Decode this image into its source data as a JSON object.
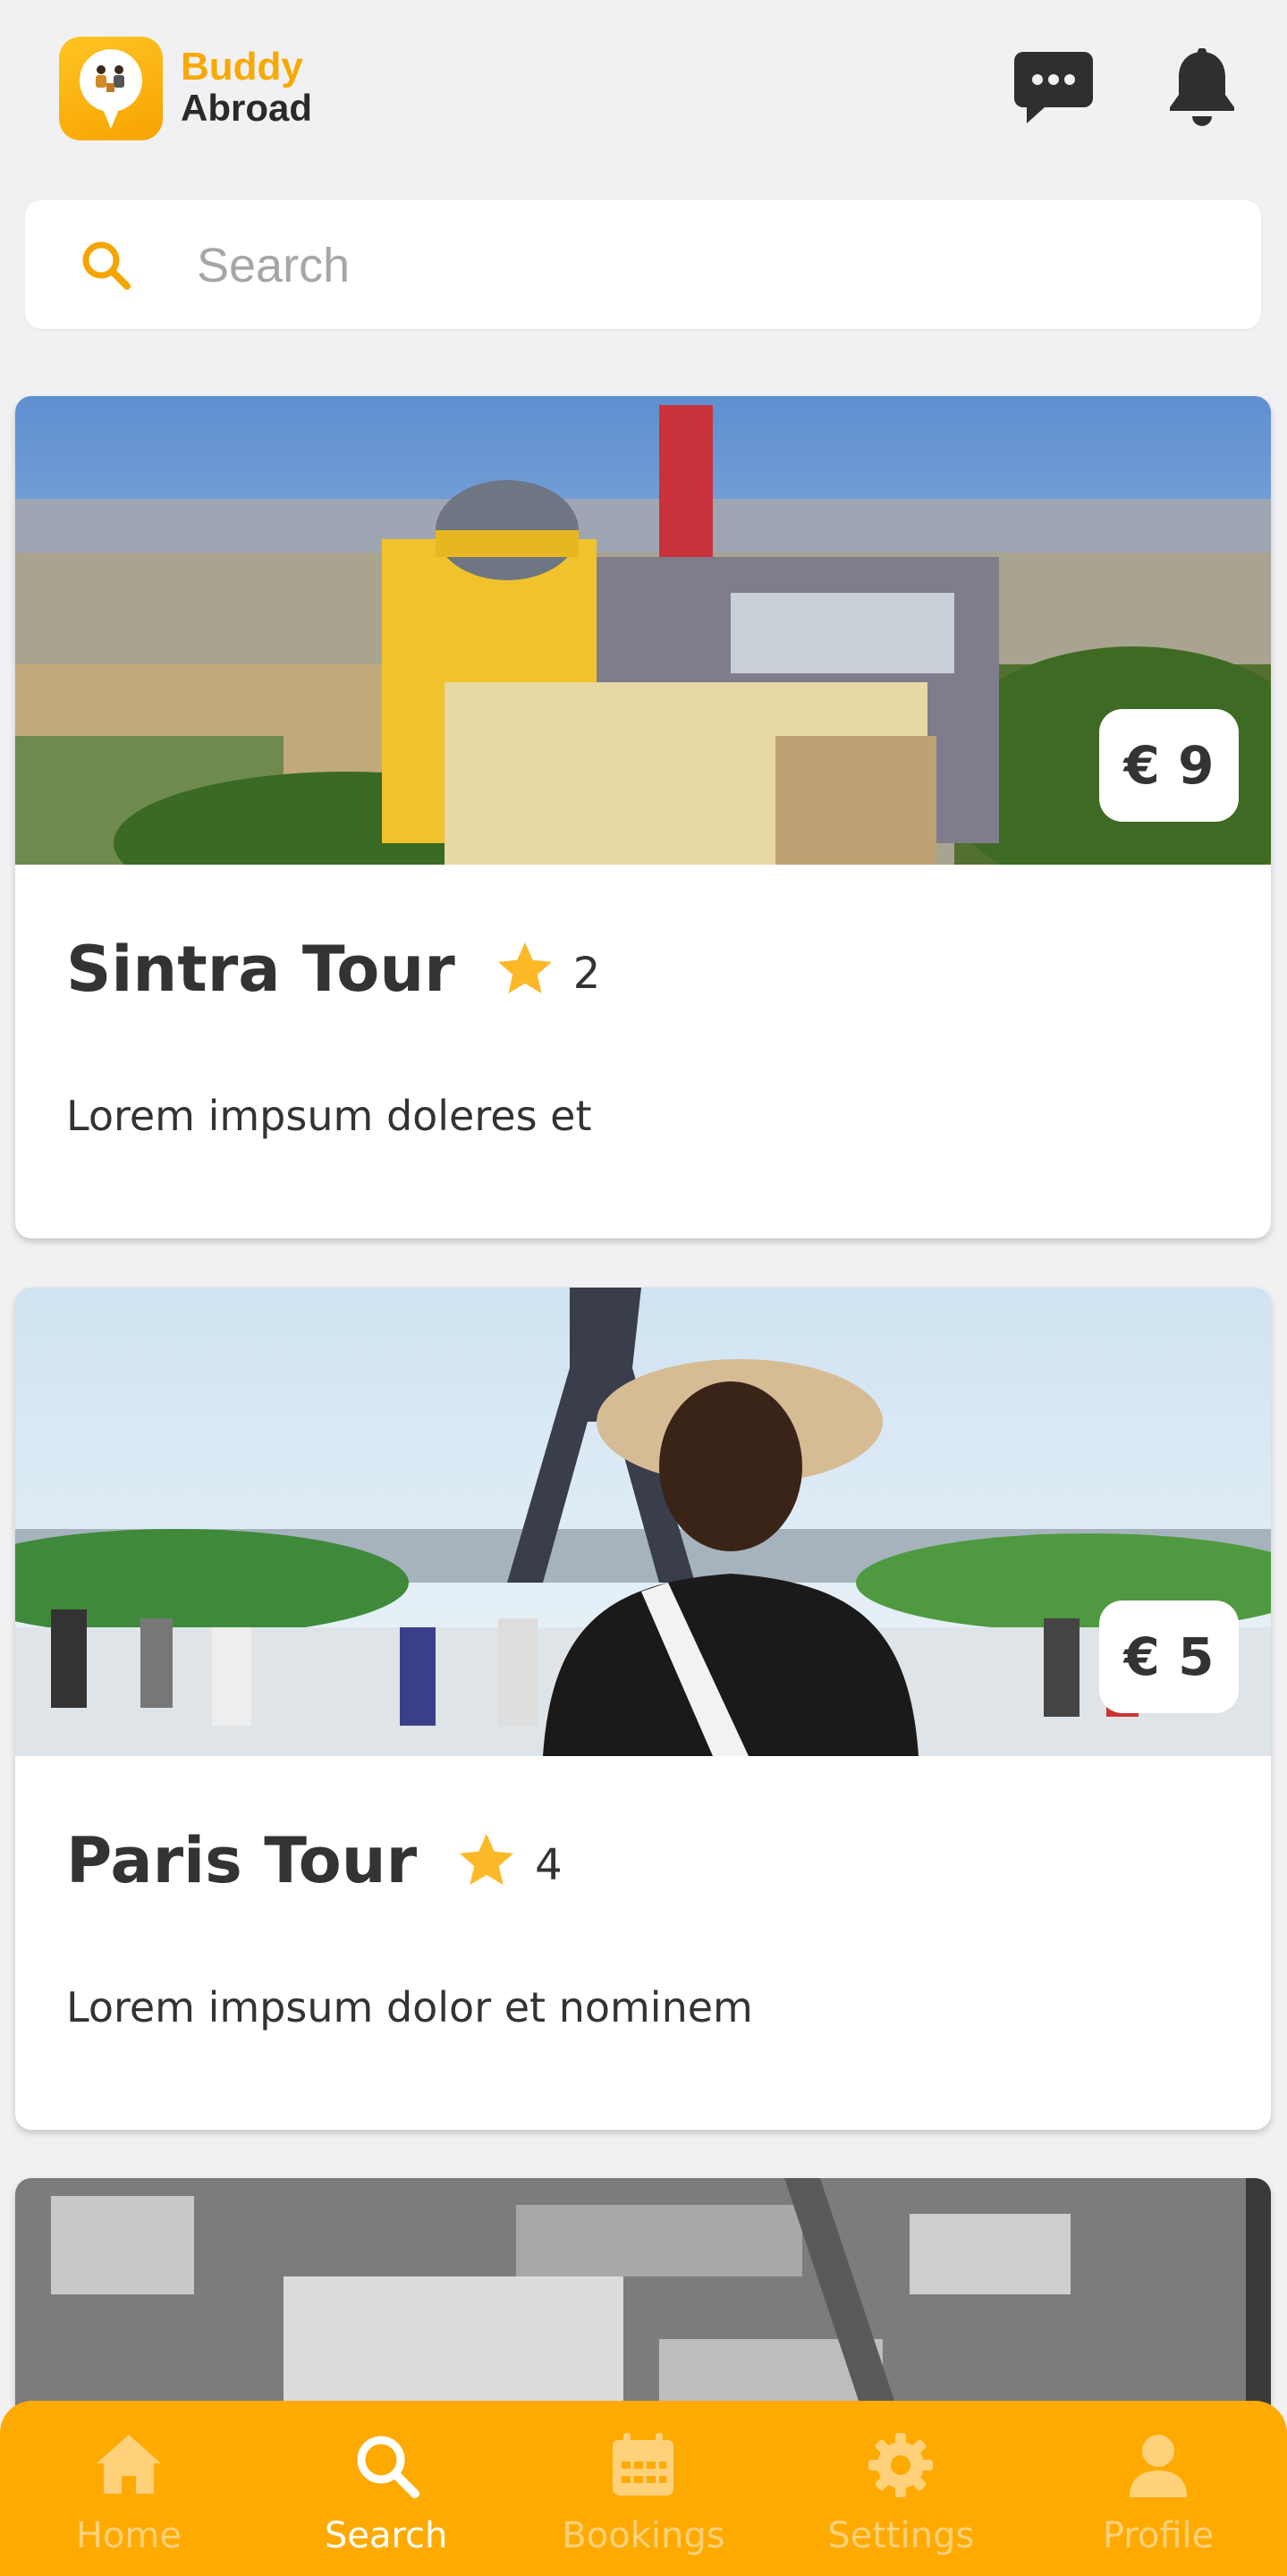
{
  "app": {
    "brand_line1": "Buddy",
    "brand_line2": "Abroad",
    "accent_color": "#ffaa00"
  },
  "header": {
    "icons": [
      "chat-icon",
      "bell-icon"
    ]
  },
  "search": {
    "placeholder": "Search",
    "value": ""
  },
  "tours": [
    {
      "title": "Sintra Tour",
      "rating": "2",
      "price": "€ 9",
      "description": "Lorem impsum doleres et"
    },
    {
      "title": "Paris Tour",
      "rating": "4",
      "price": "€ 5",
      "description": "Lorem impsum dolor et nominem"
    }
  ],
  "tabs": [
    {
      "label": "Home",
      "icon": "home-icon",
      "active": false
    },
    {
      "label": "Search",
      "icon": "search-icon",
      "active": true
    },
    {
      "label": "Bookings",
      "icon": "calendar-icon",
      "active": false
    },
    {
      "label": "Settings",
      "icon": "gear-icon",
      "active": false
    },
    {
      "label": "Profile",
      "icon": "user-icon",
      "active": false
    }
  ]
}
